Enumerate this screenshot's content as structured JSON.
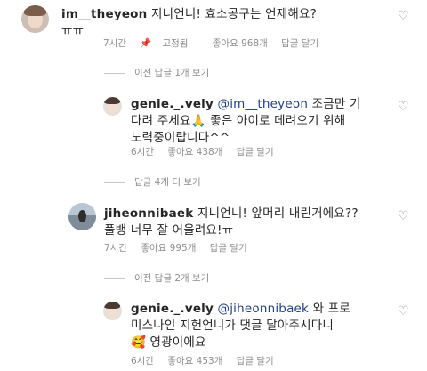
{
  "comments": [
    {
      "username": "im__theyeon",
      "mention": "",
      "body": "지니언니! 효소공구는 언제해요?",
      "line2": "ㅠㅠ",
      "time": "7시간",
      "pinned": "고정됨",
      "likes": "좋아요 968개",
      "reply": "답글 달기"
    },
    {
      "username": "genie._.vely",
      "mention": "@im__theyeon",
      "body": "조금만 기",
      "line2": "다려 주세요🙏 좋은 아이로 데려오기 위해",
      "line3": "노력중이랍니다^^",
      "time": "6시간",
      "likes": "좋아요 438개",
      "reply": "답글 달기"
    },
    {
      "username": "jiheonnibaek",
      "mention": "",
      "body": "지니언니! 앞머리 내린거에요??",
      "line2": "풀뱅 너무 잘 어울려요!ㅠ",
      "time": "7시간",
      "likes": "좋아요 995개",
      "reply": "답글 달기"
    },
    {
      "username": "genie._.vely",
      "mention": "@jiheonnibaek",
      "body": "와 프로",
      "line2": "미스나인 지헌언니가 댓글 달아주시다니",
      "line3": "🥰 영광이에요",
      "time": "6시간",
      "likes": "좋아요 453개",
      "reply": "답글 달기"
    }
  ],
  "reply_toggles": {
    "prev_1": "이전 답글 1개 보기",
    "next_4": "답글 4개 더 보기",
    "prev_2": "이전 답글 2개 보기"
  },
  "icons": {
    "heart": "heart-outline-icon",
    "pin": "pin-icon"
  },
  "colors": {
    "text": "#262626",
    "meta": "#8e8e8e",
    "mention": "#1f3f86"
  }
}
